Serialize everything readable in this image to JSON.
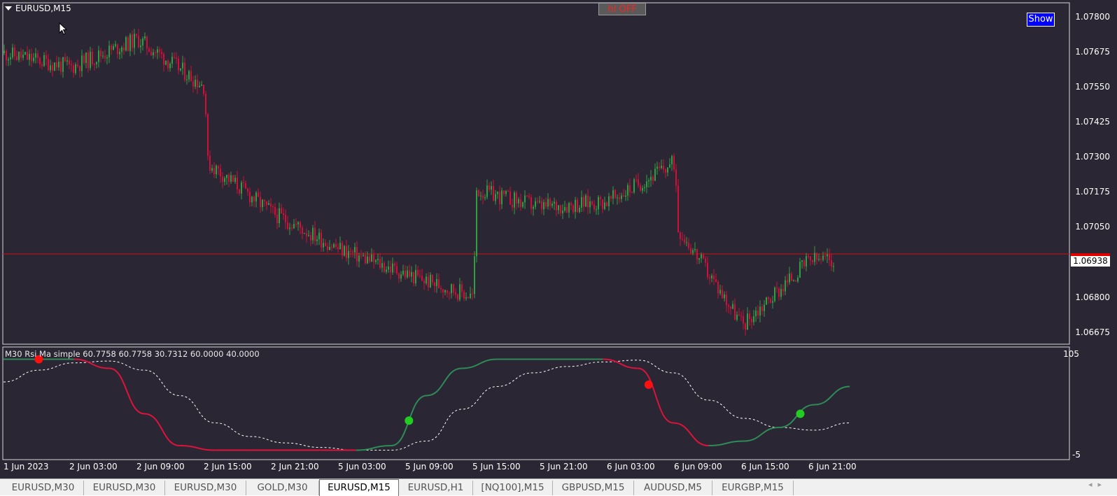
{
  "chart_title": "EURUSD,M15",
  "hl_button": "hl OFF",
  "show_button": "Show",
  "indicator_label": "M30 Rsi Ma simple 60.7758 60.7758 30.7312 60.0000 40.0000",
  "current_price": "1.06938",
  "colors": {
    "background": "#2a2633",
    "bull": "#2ea043",
    "bear": "#d0103a",
    "current_line": "#cc1010",
    "rsi_up": "#2e8b57",
    "rsi_down": "#dc143c",
    "signal_up": "#22cc22",
    "signal_down": "#ff1010"
  },
  "price_axis": [
    "1.07800",
    "1.07675",
    "1.07550",
    "1.07425",
    "1.07300",
    "1.07175",
    "1.07050",
    "1.06800",
    "1.06675"
  ],
  "sub_axis": [
    "105",
    "-5"
  ],
  "time_axis": [
    "1 Jun 2023",
    "2 Jun 03:00",
    "2 Jun 09:00",
    "2 Jun 15:00",
    "2 Jun 21:00",
    "5 Jun 03:00",
    "5 Jun 09:00",
    "5 Jun 15:00",
    "5 Jun 21:00",
    "6 Jun 03:00",
    "6 Jun 09:00",
    "6 Jun 15:00",
    "6 Jun 21:00"
  ],
  "tabs": [
    {
      "label": "EURUSD,M30",
      "active": false
    },
    {
      "label": "EURUSD,M30",
      "active": false
    },
    {
      "label": "EURUSD,M30",
      "active": false
    },
    {
      "label": "GOLD,M30",
      "active": false
    },
    {
      "label": "EURUSD,M15",
      "active": true
    },
    {
      "label": "EURUSD,H1",
      "active": false
    },
    {
      "label": "[NQ100],M15",
      "active": false
    },
    {
      "label": "GBPUSD,M15",
      "active": false
    },
    {
      "label": "AUDUSD,M5",
      "active": false
    },
    {
      "label": "EURGBP,M15",
      "active": false
    }
  ],
  "chart_data": [
    {
      "type": "candlestick",
      "title": "EURUSD,M15",
      "ylim": [
        1.0665,
        1.0785
      ],
      "current_price": 1.06938,
      "x_tick_labels": [
        "1 Jun 2023",
        "2 Jun 03:00",
        "2 Jun 09:00",
        "2 Jun 15:00",
        "2 Jun 21:00",
        "5 Jun 03:00",
        "5 Jun 09:00",
        "5 Jun 15:00",
        "5 Jun 21:00",
        "6 Jun 03:00",
        "6 Jun 09:00",
        "6 Jun 15:00",
        "6 Jun 21:00"
      ],
      "y_tick_labels": [
        "1.07800",
        "1.07675",
        "1.07550",
        "1.07425",
        "1.07300",
        "1.07175",
        "1.07050",
        "1.06800",
        "1.06675"
      ],
      "close_path": [
        {
          "x": "1 Jun 2023",
          "y": 1.0767
        },
        {
          "x": "2 Jun 03:00",
          "y": 1.0762
        },
        {
          "x": "2 Jun 09:00",
          "y": 1.0772
        },
        {
          "x": "2 Jun 15:00",
          "y": 1.0755
        },
        {
          "x": "2 Jun 15:00",
          "y": 1.0728
        },
        {
          "x": "2 Jun 21:00",
          "y": 1.071
        },
        {
          "x": "5 Jun 03:00",
          "y": 1.0697
        },
        {
          "x": "5 Jun 09:00",
          "y": 1.0688
        },
        {
          "x": "5 Jun 15:00",
          "y": 1.068
        },
        {
          "x": "5 Jun 15:00",
          "y": 1.0718
        },
        {
          "x": "5 Jun 21:00",
          "y": 1.0712
        },
        {
          "x": "6 Jun 03:00",
          "y": 1.0714
        },
        {
          "x": "6 Jun 09:00",
          "y": 1.0728
        },
        {
          "x": "6 Jun 09:00",
          "y": 1.0705
        },
        {
          "x": "6 Jun 15:00",
          "y": 1.067
        },
        {
          "x": "6 Jun 21:00",
          "y": 1.0693
        }
      ]
    },
    {
      "type": "line",
      "title": "M30 Rsi Ma simple 60.7758 60.7758 30.7312 60.0000 40.0000",
      "ylim": [
        -5,
        105
      ],
      "series": [
        {
          "values": [
            100,
            100,
            100,
            90,
            40,
            5,
            0,
            0,
            0,
            0,
            0,
            5,
            60,
            90,
            100,
            100,
            100,
            100,
            90,
            30,
            5,
            10,
            25,
            50,
            70
          ]
        },
        {
          "values": [
            75,
            88,
            96,
            98,
            88,
            60,
            30,
            15,
            8,
            3,
            0,
            0,
            10,
            45,
            70,
            85,
            92,
            97,
            99,
            85,
            55,
            35,
            25,
            22,
            30
          ]
        }
      ],
      "signals": [
        {
          "x": "2 Jun 09:00",
          "type": "down"
        },
        {
          "x": "5 Jun 15:00",
          "type": "up"
        },
        {
          "x": "6 Jun 09:00",
          "type": "down"
        },
        {
          "x": "6 Jun 21:00",
          "type": "up"
        }
      ]
    }
  ]
}
